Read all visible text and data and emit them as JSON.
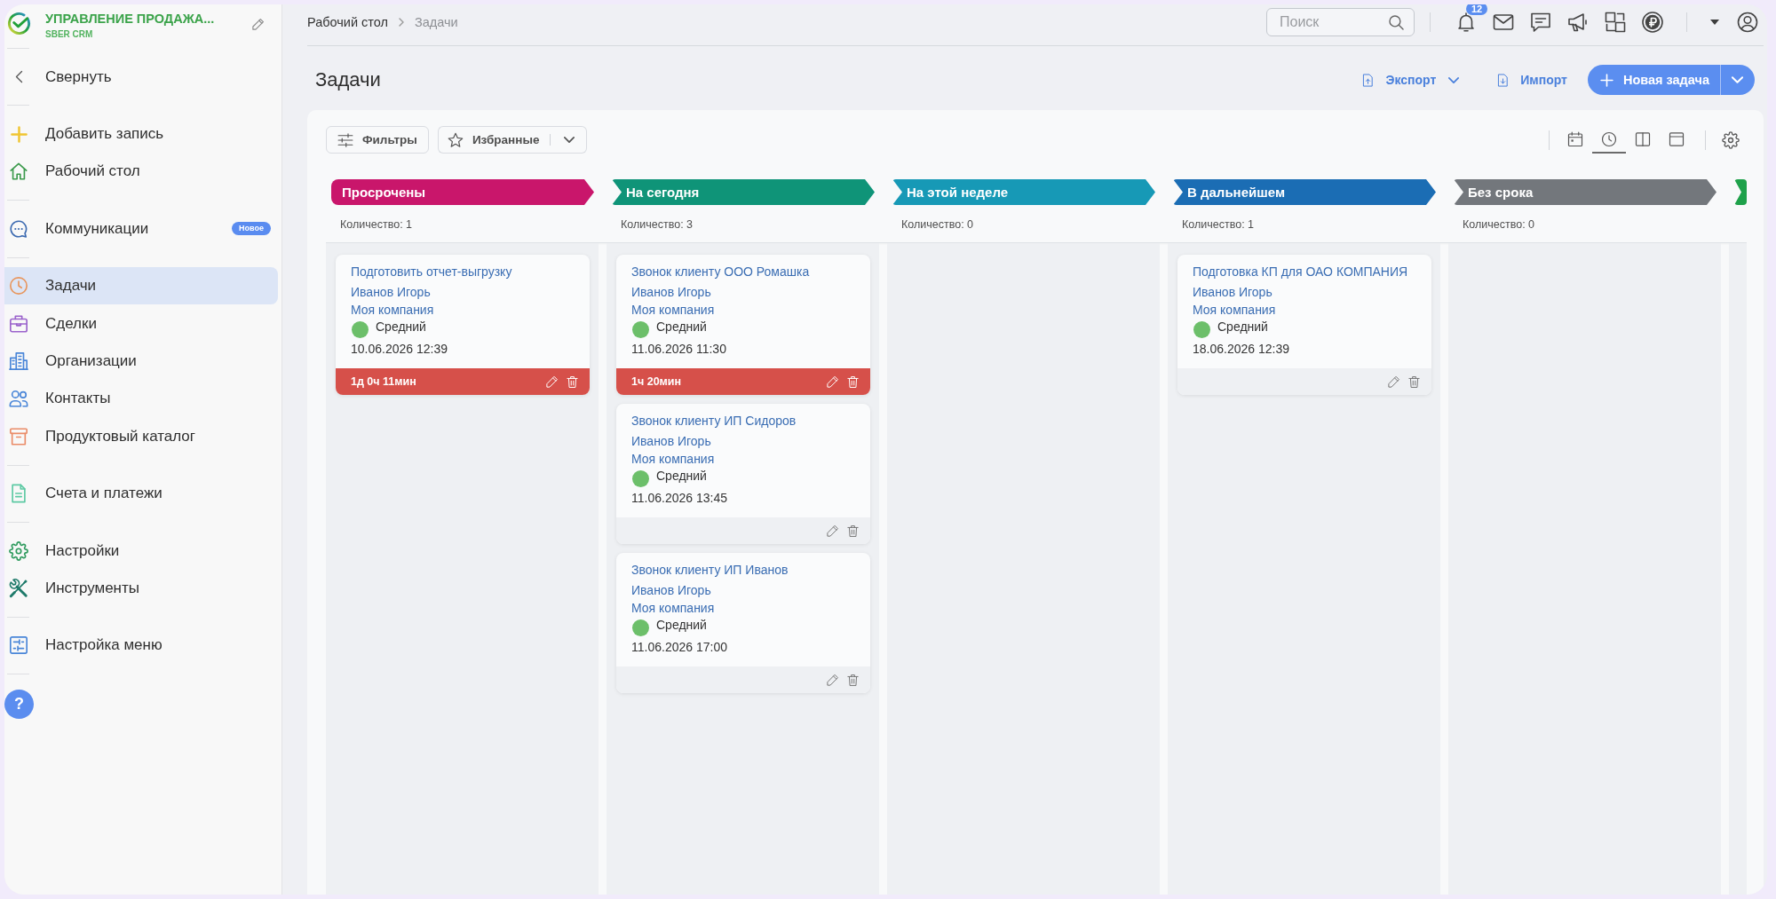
{
  "sidebar": {
    "logo_title": "УПРАВЛЕНИЕ ПРОДАЖА...",
    "logo_subtitle": "SBER CRM",
    "groups": [
      {
        "items": [
          {
            "label": "Свернуть",
            "selected": false
          }
        ]
      },
      {
        "items": [
          {
            "label": "Добавить запись",
            "selected": false
          },
          {
            "label": "Рабочий стол",
            "selected": false
          }
        ]
      },
      {
        "items": [
          {
            "label": "Коммуникации",
            "selected": false,
            "badge": "Новое"
          }
        ]
      },
      {
        "items": [
          {
            "label": "Задачи",
            "selected": true
          },
          {
            "label": "Сделки",
            "selected": false
          },
          {
            "label": "Организации",
            "selected": false
          },
          {
            "label": "Контакты",
            "selected": false
          },
          {
            "label": "Продуктовый каталог",
            "selected": false
          }
        ]
      },
      {
        "items": [
          {
            "label": "Счета и платежи",
            "selected": false
          }
        ]
      },
      {
        "items": [
          {
            "label": "Настройки",
            "selected": false
          },
          {
            "label": "Инструменты",
            "selected": false
          }
        ]
      },
      {
        "items": [
          {
            "label": "Настройка меню",
            "selected": false
          }
        ]
      }
    ],
    "help_label": "?"
  },
  "breadcrumbs": [
    "Рабочий стол",
    "Задачи"
  ],
  "search": {
    "placeholder": "Поиск"
  },
  "notifications": {
    "count": "12"
  },
  "page_title": "Задачи",
  "actions": [
    {
      "kind": "link",
      "label": "Экспорт",
      "dropdown": true
    },
    {
      "kind": "link",
      "label": "Импорт",
      "dropdown": false
    },
    {
      "kind": "primary",
      "label": "Новая задача",
      "dropdown": true
    }
  ],
  "toolbar": {
    "filters": "Фильтры",
    "favorites": "Избранные",
    "views": [
      {
        "selected": false
      },
      {
        "selected": true
      },
      {
        "selected": false
      },
      {
        "selected": false
      }
    ]
  },
  "columns": [
    {
      "title": "Просрочены",
      "color": "#c9166b",
      "count": "Количество: 1",
      "cards": [
        {
          "title": "Подготовить отчет-выгрузку",
          "assignee": "Иванов Игорь",
          "company": "Моя компания",
          "priority": "Средний",
          "color": "#6cbf6a",
          "date": "10.06.2026 12:39",
          "timer": "1д 0ч 11мин"
        }
      ]
    },
    {
      "title": "На сегодня",
      "color": "#0f9478",
      "count": "Количество: 3",
      "cards": [
        {
          "title": "Звонок клиенту ООО Ромашка",
          "assignee": "Иванов Игорь",
          "company": "Моя компания",
          "priority": "Средний",
          "color": "#6cbf6a",
          "date": "11.06.2026 11:30",
          "timer": "1ч 20мин"
        },
        {
          "title": "Звонок клиенту ИП Сидоров",
          "assignee": "Иванов Игорь",
          "company": "Моя компания",
          "priority": "Средний",
          "color": "#6cbf6a",
          "date": "11.06.2026 13:45"
        },
        {
          "title": "Звонок клиенту ИП Иванов",
          "assignee": "Иванов Игорь",
          "company": "Моя компания",
          "priority": "Средний",
          "color": "#6cbf6a",
          "date": "11.06.2026 17:00"
        }
      ]
    },
    {
      "title": "На этой неделе",
      "color": "#1799b6",
      "count": "Количество: 0"
    },
    {
      "title": "В дальнейшем",
      "color": "#1b6db4",
      "count": "Количество: 1",
      "cards": [
        {
          "title": "Подготовка КП для ОАО КОМПАНИЯ",
          "assignee": "Иванов Игорь",
          "company": "Моя компания",
          "priority": "Средний",
          "color": "#6cbf6a",
          "date": "18.06.2026 12:39"
        }
      ]
    },
    {
      "title": "Без срока",
      "color": "#73777c",
      "count": "Количество: 0"
    },
    {
      "color": "#1ea14a"
    }
  ]
}
